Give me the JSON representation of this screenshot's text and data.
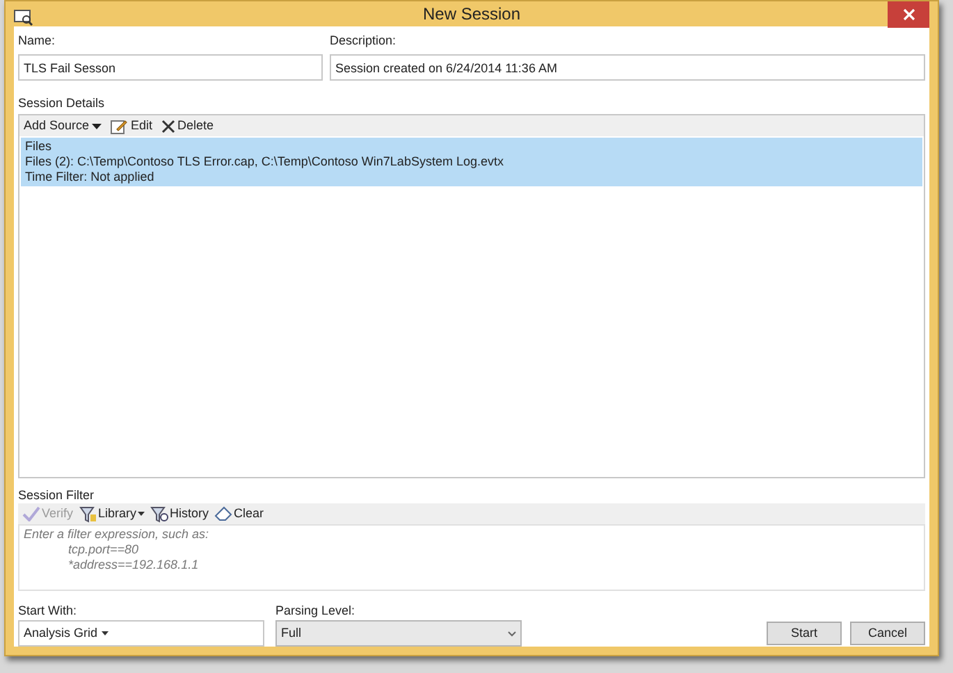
{
  "window": {
    "title": "New Session"
  },
  "name": {
    "label": "Name:",
    "value": "TLS Fail Sesson"
  },
  "description": {
    "label": "Description:",
    "value": "Session created on 6/24/2014 11:36 AM"
  },
  "session_details": {
    "label": "Session Details",
    "toolbar": [
      {
        "kind": "dropdown",
        "label": "Add Source"
      },
      {
        "kind": "edit",
        "label": "Edit"
      },
      {
        "kind": "delete",
        "label": "Delete"
      }
    ],
    "items": [
      {
        "title": "Files",
        "lines": [
          "Files (2): C:\\Temp\\Contoso TLS Error.cap, C:\\Temp\\Contoso Win7LabSystem Log.evtx",
          "Time Filter: Not applied"
        ],
        "selected": true
      }
    ]
  },
  "session_filter": {
    "label": "Session Filter",
    "toolbar": [
      {
        "kind": "verify",
        "label": "Verify",
        "disabled": true
      },
      {
        "kind": "library",
        "label": "Library",
        "disabled": false
      },
      {
        "kind": "history",
        "label": "History",
        "disabled": false
      },
      {
        "kind": "clear",
        "label": "Clear",
        "disabled": false
      }
    ],
    "placeholder_lines": [
      "Enter a filter expression, such as:",
      "tcp.port==80",
      "*address==192.168.1.1"
    ]
  },
  "start_with": {
    "label": "Start With:",
    "value": "Analysis Grid"
  },
  "parsing_level": {
    "label": "Parsing Level:",
    "value": "Full"
  },
  "buttons": [
    "Start",
    "Cancel"
  ]
}
